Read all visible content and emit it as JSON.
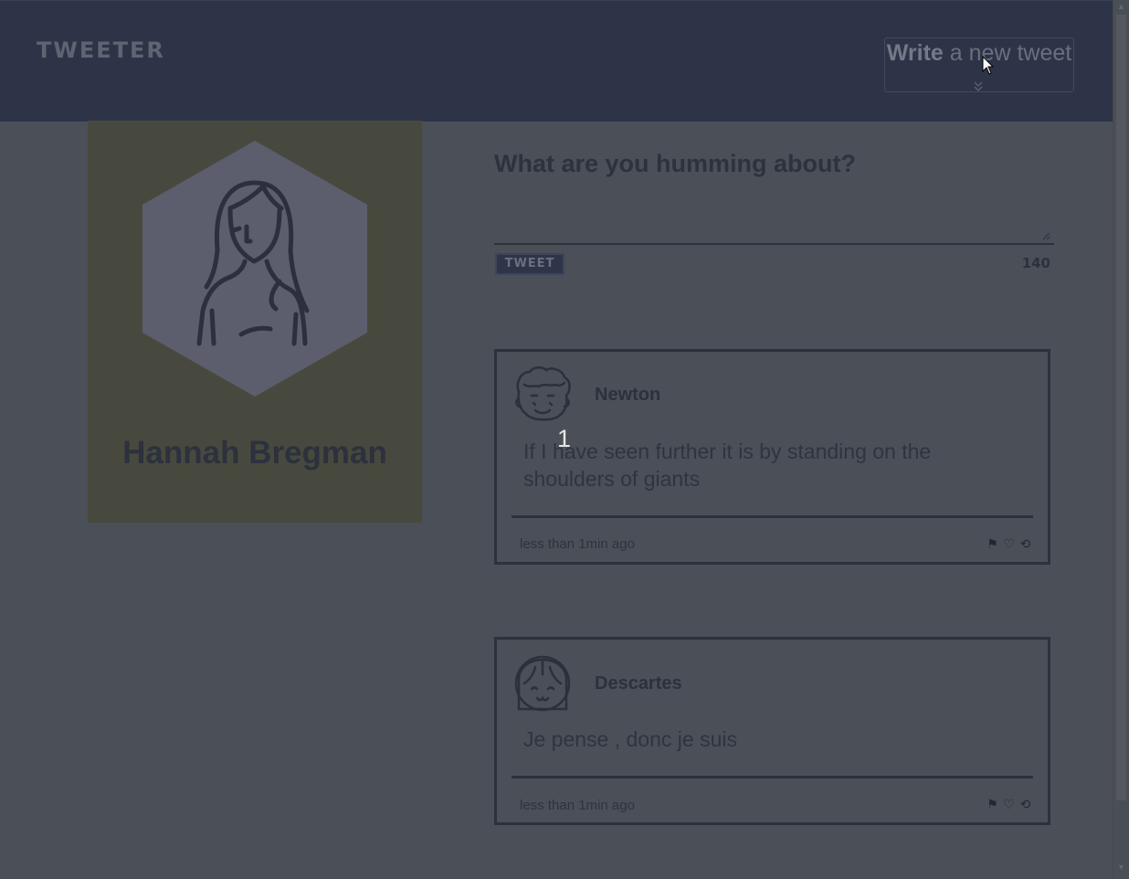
{
  "header": {
    "brand": "TWEETER",
    "compose_bold": "Write",
    "compose_rest": " a new tweet"
  },
  "profile": {
    "name": "Hannah Bregman"
  },
  "composer": {
    "prompt": "What are you humming about?",
    "placeholder": "",
    "button_label": "TWEET",
    "char_counter": "140"
  },
  "tweets": [
    {
      "author": "Newton",
      "text": "If I have seen further it is by standing on the shoulders of giants",
      "time": "less than 1min ago"
    },
    {
      "author": "Descartes",
      "text": "Je pense , donc je suis",
      "time": "less than 1min ago"
    }
  ],
  "overlay_badge": "1",
  "icons": {
    "flag": "flag-icon",
    "heart": "heart-icon",
    "retweet": "retweet-icon",
    "chevron": "chevron-down-icon"
  }
}
